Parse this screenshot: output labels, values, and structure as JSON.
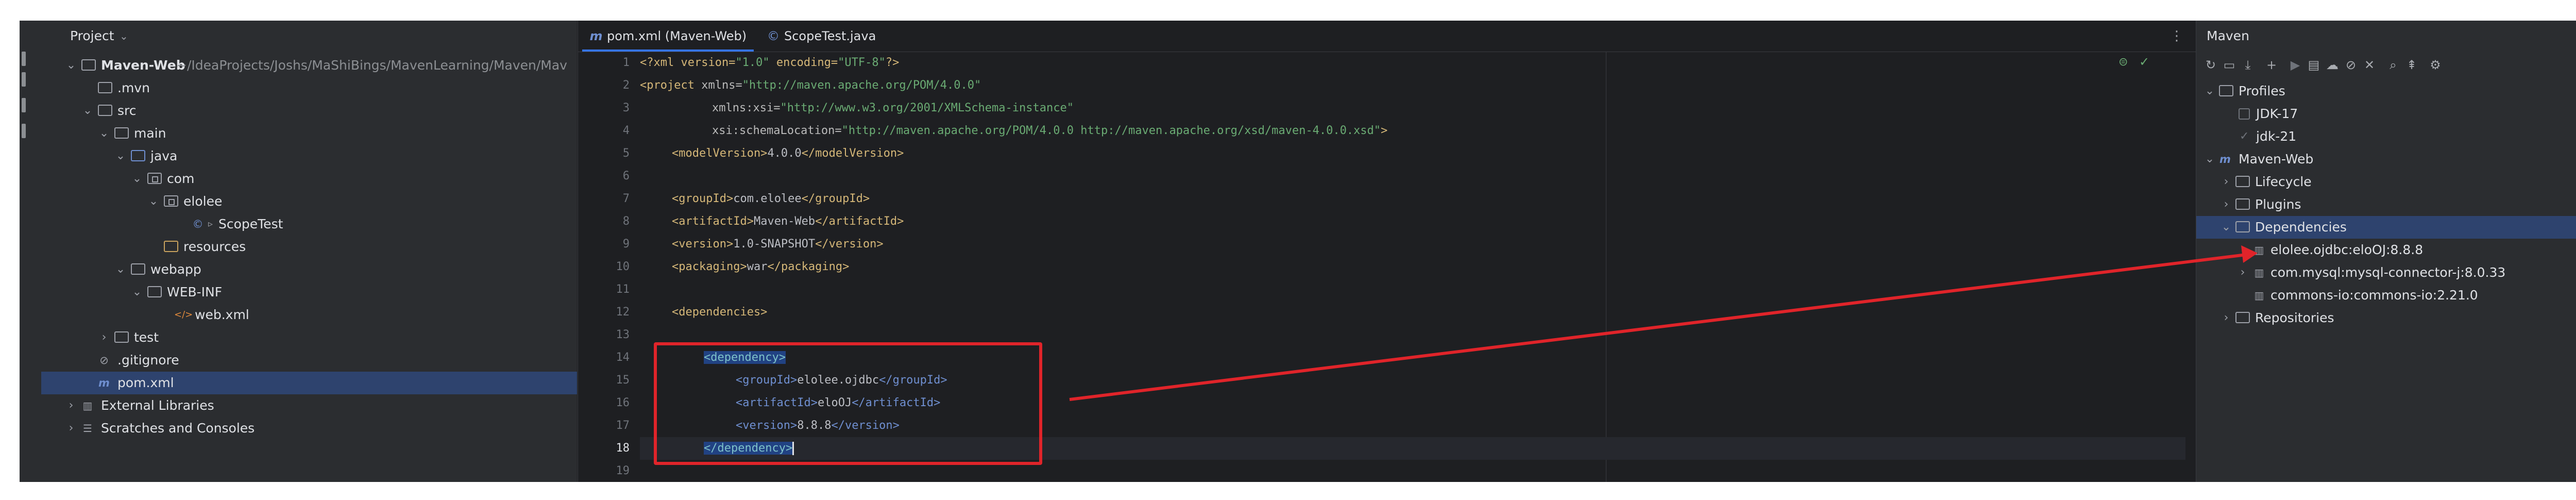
{
  "project": {
    "title": "Project",
    "tree": [
      {
        "label": "Maven-Web",
        "extra": "~/IdeaProjects/Joshs/MaShiBings/MavenLearning/Maven/Mav"
      },
      {
        "label": ".mvn"
      },
      {
        "label": "src"
      },
      {
        "label": "main"
      },
      {
        "label": "java"
      },
      {
        "label": "com"
      },
      {
        "label": "elolee"
      },
      {
        "label": "ScopeTest"
      },
      {
        "label": "resources"
      },
      {
        "label": "webapp"
      },
      {
        "label": "WEB-INF"
      },
      {
        "label": "web.xml"
      },
      {
        "label": "test"
      },
      {
        "label": ".gitignore"
      },
      {
        "label": "pom.xml"
      },
      {
        "label": "External Libraries"
      },
      {
        "label": "Scratches and Consoles"
      }
    ]
  },
  "editor": {
    "tabs": [
      {
        "label": "pom.xml (Maven-Web)"
      },
      {
        "label": "ScopeTest.java"
      }
    ],
    "line_numbers": [
      "1",
      "2",
      "3",
      "4",
      "5",
      "6",
      "7",
      "8",
      "9",
      "10",
      "11",
      "12",
      "13",
      "14",
      "15",
      "16",
      "17",
      "18",
      "19"
    ],
    "code": {
      "l1_a": "<?xml version=",
      "l1_b": "\"1.0\"",
      "l1_c": " encoding=",
      "l1_d": "\"UTF-8\"",
      "l1_e": "?>",
      "l2_a": "<project",
      "l2_b": " xmlns=",
      "l2_c": "\"http://maven.apache.org/POM/4.0.0\"",
      "l3_a": "xmlns:xsi=",
      "l3_b": "\"http://www.w3.org/2001/XMLSchema-instance\"",
      "l4_a": "xsi:schemaLocation=",
      "l4_b": "\"http://maven.apache.org/POM/4.0.0 http://maven.apache.org/xsd/maven-4.0.0.xsd\"",
      "l4_c": ">",
      "l5_open": "<modelVersion>",
      "l5_val": "4.0.0",
      "l5_close": "</modelVersion>",
      "l7_open": "<groupId>",
      "l7_val": "com.elolee",
      "l7_close": "</groupId>",
      "l8_open": "<artifactId>",
      "l8_val": "Maven-Web",
      "l8_close": "</artifactId>",
      "l9_open": "<version>",
      "l9_val": "1.0-SNAPSHOT",
      "l9_close": "</version>",
      "l10_open": "<packaging>",
      "l10_val": "war",
      "l10_close": "</packaging>",
      "l12": "<dependencies>",
      "l14": "<dependency>",
      "l15_open": "<groupId>",
      "l15_val": "elolee.ojdbc",
      "l15_close": "</groupId>",
      "l16_open": "<artifactId>",
      "l16_val": "eloOJ",
      "l16_close": "</artifactId>",
      "l17_open": "<version>",
      "l17_val": "8.8.8",
      "l17_close": "</version>",
      "l18": "</dependency>"
    }
  },
  "maven": {
    "title": "Maven",
    "tree": [
      {
        "label": "Profiles"
      },
      {
        "label": "JDK-17"
      },
      {
        "label": "jdk-21"
      },
      {
        "label": "Maven-Web"
      },
      {
        "label": "Lifecycle"
      },
      {
        "label": "Plugins"
      },
      {
        "label": "Dependencies"
      },
      {
        "label": "elolee.ojdbc:eloOJ:8.8.8"
      },
      {
        "label": "com.mysql:mysql-connector-j:8.0.33"
      },
      {
        "label": "commons-io:commons-io:2.21.0"
      },
      {
        "label": "Repositories"
      }
    ]
  },
  "colors": {
    "background": "#1e1f22",
    "panel": "#2b2d30",
    "selection": "#2e436e",
    "annotation_red": "#e0242a",
    "accent": "#3574f0"
  }
}
